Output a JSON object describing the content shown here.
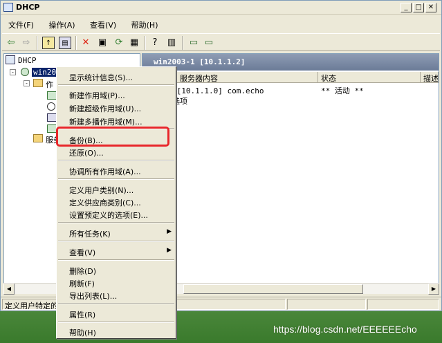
{
  "window": {
    "title": "DHCP"
  },
  "menubar": [
    {
      "label": "文件(F)"
    },
    {
      "label": "操作(A)"
    },
    {
      "label": "查看(V)"
    },
    {
      "label": "帮助(H)"
    }
  ],
  "tree": {
    "root": "DHCP",
    "server": "win2003-1",
    "scope": "作",
    "server_options": "服务"
  },
  "right_pane": {
    "header": "win2003-1 [10.1.1.2]",
    "columns": [
      "服务器内容",
      "状态",
      "描述"
    ],
    "rows": [
      {
        "content": "作用域 [10.1.1.0] com.echo",
        "status": "** 活动 **"
      },
      {
        "content": "服务器选项",
        "status": ""
      }
    ]
  },
  "statusbar": {
    "text": "定义用户特定的"
  },
  "context_menu": {
    "items": [
      {
        "label": "显示统计信息(S)..."
      },
      {
        "label": "新建作用域(P)..."
      },
      {
        "label": "新建超级作用域(U)..."
      },
      {
        "label": "新建多播作用域(M)..."
      },
      {
        "label": "备份(B)..."
      },
      {
        "label": "还原(O)..."
      },
      {
        "label": "协调所有作用域(A)..."
      },
      {
        "label": "定义用户类别(N)..."
      },
      {
        "label": "定义供应商类别(C)..."
      },
      {
        "label": "设置预定义的选项(E)..."
      },
      {
        "label": "所有任务(K)"
      },
      {
        "label": "查看(V)"
      },
      {
        "label": "删除(D)"
      },
      {
        "label": "刷新(F)"
      },
      {
        "label": "导出列表(L)..."
      },
      {
        "label": "属性(R)"
      },
      {
        "label": "帮助(H)"
      }
    ]
  },
  "watermark": "https://blog.csdn.net/EEEEEEcho",
  "colors": {
    "highlight_border": "#e8262a",
    "title_bg": "#ece9d8"
  }
}
